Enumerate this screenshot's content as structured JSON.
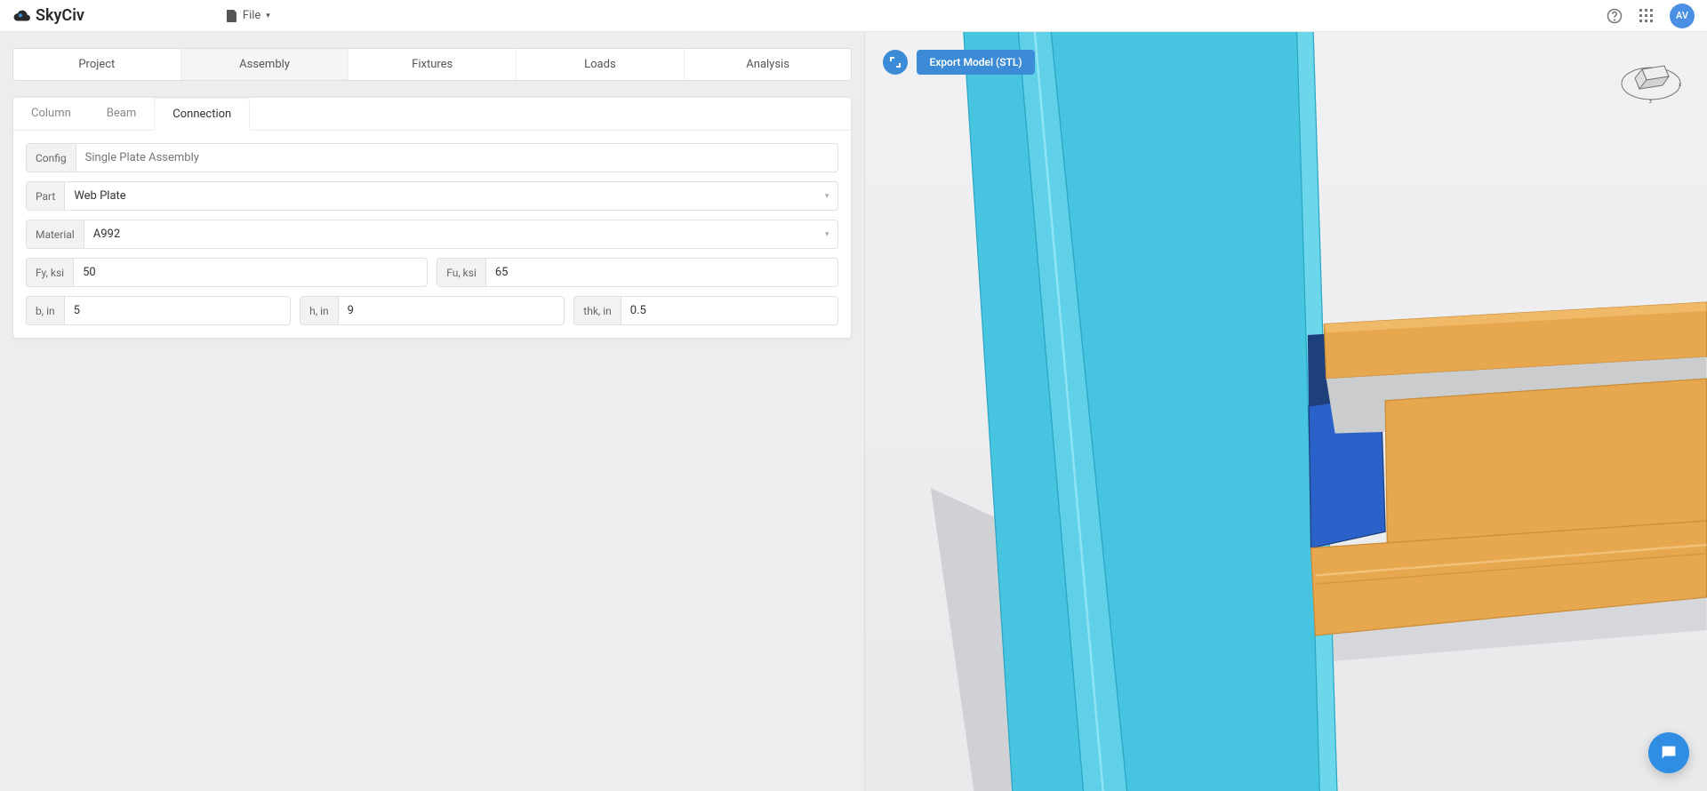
{
  "brand": "SkyCiv",
  "file_menu_label": "File",
  "avatar_initials": "AV",
  "main_tabs": {
    "project": "Project",
    "assembly": "Assembly",
    "fixtures": "Fixtures",
    "loads": "Loads",
    "analysis": "Analysis",
    "active": "assembly"
  },
  "sub_tabs": {
    "column": "Column",
    "beam": "Beam",
    "connection": "Connection",
    "active": "connection"
  },
  "connection": {
    "config_label": "Config",
    "config_placeholder": "Single Plate Assembly",
    "part_label": "Part",
    "part_value": "Web Plate",
    "material_label": "Material",
    "material_value": "A992",
    "fy_label": "Fy, ksi",
    "fy_value": "50",
    "fu_label": "Fu, ksi",
    "fu_value": "65",
    "b_label": "b, in",
    "b_value": "5",
    "h_label": "h, in",
    "h_value": "9",
    "thk_label": "thk, in",
    "thk_value": "0.5"
  },
  "viewport": {
    "export_label": "Export Model (STL)",
    "colors": {
      "column": "#47c4e0",
      "column_edge": "#2aa7c4",
      "beam": "#e6a74e",
      "beam_edge": "#c98c39",
      "plate": "#2a62c9",
      "plate_dark": "#1d3f7a"
    }
  }
}
